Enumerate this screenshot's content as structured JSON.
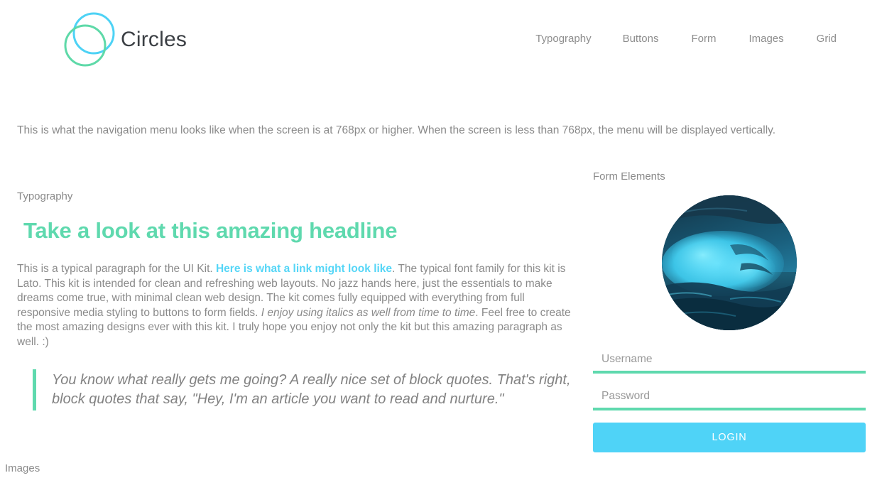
{
  "header": {
    "brand_name": "Circles",
    "logo": {
      "icon": "two-overlapping-circles-icon",
      "circle_top_color": "#4dd2f5",
      "circle_bottom_color": "#5ed9a8"
    },
    "nav": [
      {
        "label": "Typography"
      },
      {
        "label": "Buttons"
      },
      {
        "label": "Form"
      },
      {
        "label": "Images"
      },
      {
        "label": "Grid"
      }
    ]
  },
  "intro": {
    "text": "This is what the navigation menu looks like when the screen is at 768px or higher. When the screen is less than 768px, the menu will be displayed vertically."
  },
  "typography": {
    "section_label": "Typography",
    "headline": "Take a look at this amazing headline",
    "paragraph": {
      "part1": "This is a typical paragraph for the UI Kit. ",
      "link_text": "Here is what a link might look like",
      "part2": ". The typical font family for this kit is Lato. This kit is intended for clean and refreshing web layouts. No jazz hands here, just the essentials to make dreams come true, with minimal clean web design. The kit comes fully equipped with everything from full responsive media styling to buttons to form fields. ",
      "italic_text": "I enjoy using italics as well from time to time",
      "part3": ". Feel free to create the most amazing designs ever with this kit. I truly hope you enjoy not only the kit but this amazing paragraph as well. :)"
    },
    "blockquote": "You know what really gets me going? A really nice set of block quotes. That's right, block quotes that say, \"Hey, I'm an article you want to read and nurture.\""
  },
  "form": {
    "section_label": "Form Elements",
    "avatar": {
      "icon": "ocean-wave-avatar-image",
      "alt": "Circular photo of a cyan ocean wave"
    },
    "username": {
      "placeholder": "Username",
      "value": ""
    },
    "password": {
      "placeholder": "Password",
      "value": ""
    },
    "login_label": "LOGIN"
  },
  "images": {
    "section_label": "Images"
  },
  "colors": {
    "accent_green": "#5fd9ae",
    "accent_cyan": "#4fd3f7",
    "text_gray": "#8a8a8a",
    "brand_dark": "#3b3f44"
  }
}
